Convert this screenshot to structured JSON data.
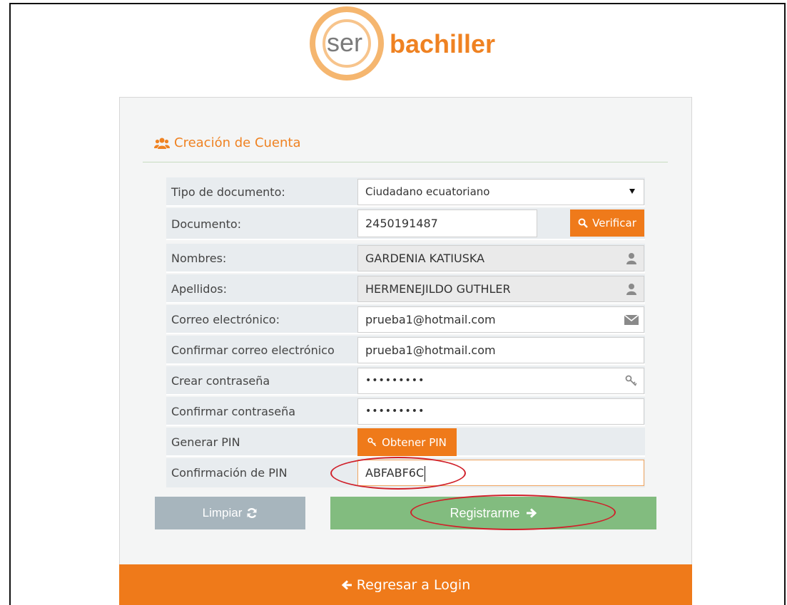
{
  "logo": {
    "ser": "ser",
    "bachiller": "bachiller"
  },
  "card": {
    "title": "Creación de Cuenta"
  },
  "form": {
    "tipo_documento": {
      "label": "Tipo de documento:",
      "value": "Ciudadano ecuatoriano"
    },
    "documento": {
      "label": "Documento:",
      "value": "2450191487",
      "verify_label": "Verificar"
    },
    "nombres": {
      "label": "Nombres:",
      "value": "GARDENIA KATIUSKA"
    },
    "apellidos": {
      "label": "Apellidos:",
      "value": "HERMENEJILDO GUTHLER"
    },
    "correo": {
      "label": "Correo electrónico:",
      "value": "prueba1@hotmail.com"
    },
    "confirmar_correo": {
      "label": "Confirmar correo electrónico",
      "value": "prueba1@hotmail.com"
    },
    "crear_contrasena": {
      "label": "Crear contraseña",
      "value": "•••••••••"
    },
    "confirmar_contrasena": {
      "label": "Confirmar contraseña",
      "value": "•••••••••"
    },
    "generar_pin": {
      "label": "Generar PIN",
      "button_label": "Obtener PIN"
    },
    "confirmacion_pin": {
      "label": "Confirmación de PIN",
      "value": "ABFABF6C"
    }
  },
  "buttons": {
    "clear_label": "Limpiar",
    "register_label": "Registrarme",
    "login_label": "Regresar a Login"
  },
  "colors": {
    "brand_orange": "#ef7a1a",
    "register_green": "#82bc7f",
    "clear_gray": "#a7b5bd",
    "annotation_red": "#d0202a"
  }
}
